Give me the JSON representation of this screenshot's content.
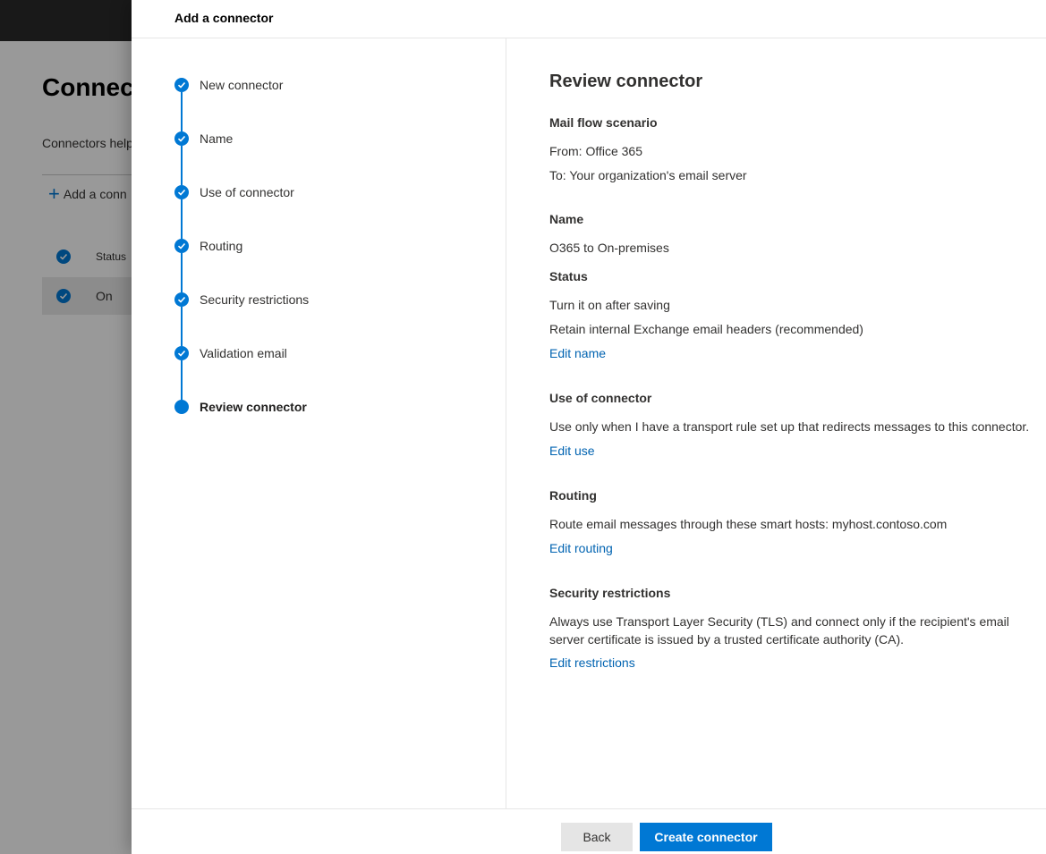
{
  "background": {
    "page_title": "Connect",
    "description": "Connectors help",
    "add_button": "Add a conn",
    "table_header_status": "Status",
    "row_status": "On"
  },
  "panel": {
    "title": "Add a connector",
    "steps": [
      {
        "label": "New connector",
        "state": "done"
      },
      {
        "label": "Name",
        "state": "done"
      },
      {
        "label": "Use of connector",
        "state": "done"
      },
      {
        "label": "Routing",
        "state": "done"
      },
      {
        "label": "Security restrictions",
        "state": "done"
      },
      {
        "label": "Validation email",
        "state": "done"
      },
      {
        "label": "Review connector",
        "state": "current"
      }
    ],
    "review": {
      "heading": "Review connector",
      "mail_flow": {
        "title": "Mail flow scenario",
        "from": "From: Office 365",
        "to": "To: Your organization's email server"
      },
      "name": {
        "title": "Name",
        "value": "O365 to On-premises"
      },
      "status": {
        "title": "Status",
        "line1": "Turn it on after saving",
        "line2": "Retain internal Exchange email headers (recommended)",
        "edit_link": "Edit name"
      },
      "use": {
        "title": "Use of connector",
        "value": "Use only when I have a transport rule set up that redirects messages to this connector.",
        "edit_link": "Edit use"
      },
      "routing": {
        "title": "Routing",
        "value": "Route email messages through these smart hosts: myhost.contoso.com",
        "edit_link": "Edit routing"
      },
      "security": {
        "title": "Security restrictions",
        "value": "Always use Transport Layer Security (TLS) and connect only if the recipient's email server certificate is issued by a trusted certificate authority (CA).",
        "edit_link": "Edit restrictions"
      }
    },
    "footer": {
      "back_label": "Back",
      "create_label": "Create connector"
    }
  },
  "colors": {
    "accent": "#0078d4",
    "link": "#0063b1",
    "topbar": "#2b2b2b"
  }
}
